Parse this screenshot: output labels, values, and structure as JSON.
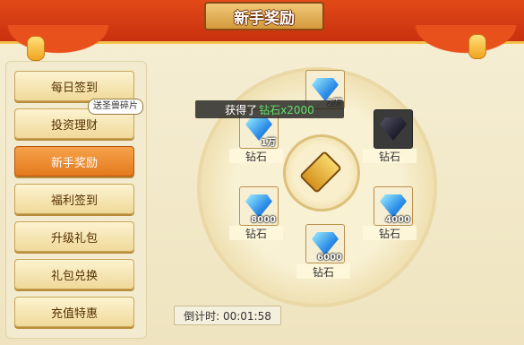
{
  "window": {
    "title": "新手奖励"
  },
  "sidebar": {
    "items": [
      {
        "label": "每日签到"
      },
      {
        "label": "投资理财"
      },
      {
        "label": "新手奖励",
        "active": true
      },
      {
        "label": "福利签到"
      },
      {
        "label": "升级礼包"
      },
      {
        "label": "礼包兑换"
      },
      {
        "label": "充值特惠"
      }
    ],
    "tooltip": "送圣兽碎片"
  },
  "wheel": {
    "rewards": [
      {
        "name": "钻石",
        "qty": "2万"
      },
      {
        "name": "钻石",
        "qty": "",
        "received": true
      },
      {
        "name": "钻石",
        "qty": "4000"
      },
      {
        "name": "钻石",
        "qty": "6000"
      },
      {
        "name": "钻石",
        "qty": "8000"
      },
      {
        "name": "钻石",
        "qty": "1万"
      }
    ]
  },
  "toast": {
    "prefix": "获得了",
    "highlight": "钻石x2000"
  },
  "timer": {
    "text": "倒计时: 00:01:58"
  },
  "colors": {
    "accent": "#e47a1d",
    "banner": "#c8300f",
    "highlight_text": "#5fe36a"
  },
  "icons": {
    "reward": "diamond-icon",
    "pointer": "arrow-pointer-icon"
  }
}
